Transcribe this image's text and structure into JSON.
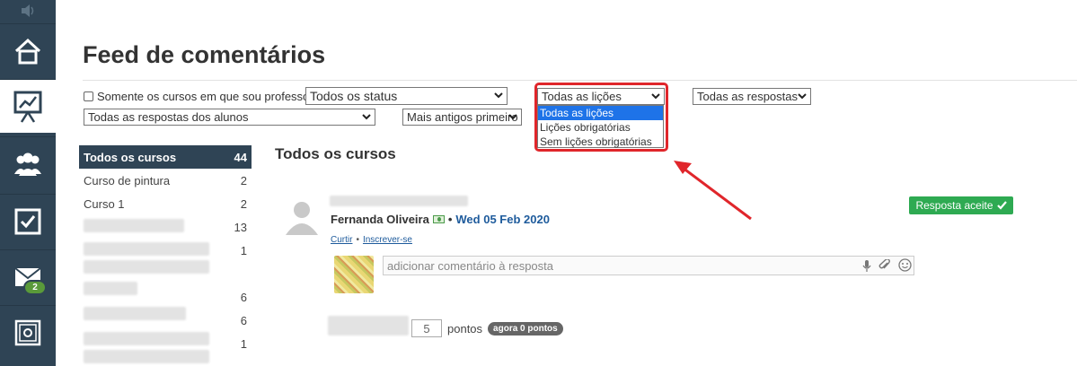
{
  "nav": {
    "items": [
      {
        "icon": "home-icon"
      },
      {
        "icon": "presentation-chart-icon",
        "active": true
      },
      {
        "icon": "users-group-icon"
      },
      {
        "icon": "checkbox-icon"
      },
      {
        "icon": "mail-icon",
        "badge": "2"
      },
      {
        "icon": "safe-icon"
      }
    ]
  },
  "page": {
    "title": "Feed de comentários"
  },
  "filters": {
    "only_my_courses_label": "Somente os cursos em que sou professor",
    "status_value": "Todos os status",
    "lessons_value": "Todas as lições",
    "responses_value": "Todas as respostas",
    "student_responses_value": "Todas as respostas dos alunos",
    "sort_value": "Mais antigos primeiro"
  },
  "lessons_dropdown": {
    "options": [
      "Todas as lições",
      "Lições obrigatórias",
      "Sem lições obrigatórias"
    ],
    "selected_index": 0
  },
  "sidebar": {
    "courses": [
      {
        "name": "Todos os cursos",
        "count": "44",
        "active": true
      },
      {
        "name": "Curso de pintura",
        "count": "2"
      },
      {
        "name": "Curso 1",
        "count": "2"
      },
      {
        "name": "",
        "count": "13"
      },
      {
        "name": "",
        "count": "1"
      },
      {
        "name": "",
        "count": ""
      },
      {
        "name": "",
        "count": "6"
      },
      {
        "name": "",
        "count": "6"
      },
      {
        "name": "",
        "count": "1"
      }
    ]
  },
  "main": {
    "section_title": "Todos os cursos",
    "comment": {
      "author": "Fernanda Oliveira",
      "separator": "•",
      "date": "Wed 05 Feb 2020",
      "like_label": "Curtir",
      "subscribe_label": "Inscrever-se",
      "accepted_label": "Resposta aceite",
      "reply_placeholder": "adicionar comentário à resposta"
    },
    "points": {
      "value": "5",
      "label": "pontos",
      "badge": "agora 0 pontos"
    }
  },
  "colors": {
    "sidebar_bg": "#2f4455",
    "accent_blue": "#1e5b9c",
    "accept_green": "#2eaa52",
    "highlight_red": "#e0262b"
  }
}
